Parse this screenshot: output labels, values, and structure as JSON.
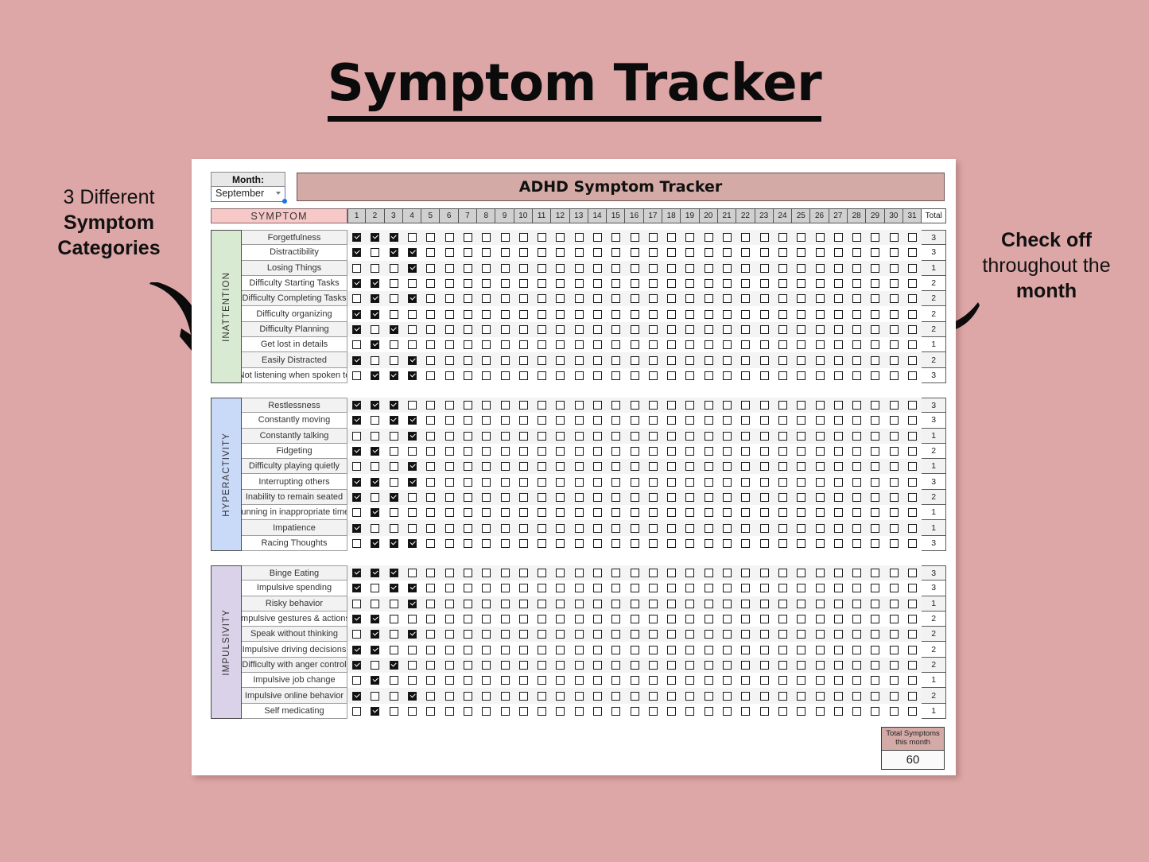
{
  "page": {
    "title": "Symptom Tracker",
    "background_color": "#dda7a7"
  },
  "annotations": {
    "left": {
      "line1": "3 Different",
      "line2": "Symptom",
      "line3": "Categories"
    },
    "right": {
      "line1": "Check off",
      "line2": "throughout the",
      "line3": "month"
    }
  },
  "sheet": {
    "month_label": "Month:",
    "month_value": "September",
    "title_bar": "ADHD Symptom Tracker",
    "symptom_header": "SYMPTOM",
    "days": [
      "1",
      "2",
      "3",
      "4",
      "5",
      "6",
      "7",
      "8",
      "9",
      "10",
      "11",
      "12",
      "13",
      "14",
      "15",
      "16",
      "17",
      "18",
      "19",
      "20",
      "21",
      "22",
      "23",
      "24",
      "25",
      "26",
      "27",
      "28",
      "29",
      "30",
      "31"
    ],
    "total_header": "Total",
    "footer": {
      "label": "Total Symptoms this month",
      "value": "60"
    },
    "category_colors": {
      "inattention": "#d9ead3",
      "hyperactivity": "#c9daf8",
      "impulsivity": "#d9d2e9",
      "header_pink": "#f6c8c8",
      "title_bar": "#d3aaa6"
    },
    "blocks": [
      {
        "category": "INATTENTION",
        "color": "#d9ead3",
        "rows": [
          {
            "name": "Forgetfulness",
            "checks": [
              1,
              1,
              1,
              0
            ],
            "total": "3"
          },
          {
            "name": "Distractibility",
            "checks": [
              1,
              0,
              1,
              1
            ],
            "total": "3"
          },
          {
            "name": "Losing Things",
            "checks": [
              0,
              0,
              0,
              1
            ],
            "total": "1"
          },
          {
            "name": "Difficulty Starting Tasks",
            "checks": [
              1,
              1,
              0,
              0
            ],
            "total": "2"
          },
          {
            "name": "Difficulty Completing Tasks",
            "checks": [
              0,
              1,
              0,
              1
            ],
            "total": "2"
          },
          {
            "name": "Difficulty organizing",
            "checks": [
              1,
              1,
              0,
              0
            ],
            "total": "2"
          },
          {
            "name": "Difficulty Planning",
            "checks": [
              1,
              0,
              1,
              0
            ],
            "total": "2"
          },
          {
            "name": "Get lost in details",
            "checks": [
              0,
              1,
              0,
              0
            ],
            "total": "1"
          },
          {
            "name": "Easily Distracted",
            "checks": [
              1,
              0,
              0,
              1
            ],
            "total": "2"
          },
          {
            "name": "Not listening when spoken to",
            "checks": [
              0,
              1,
              1,
              1
            ],
            "total": "3"
          }
        ]
      },
      {
        "category": "HYPERACTIVITY",
        "color": "#c9daf8",
        "rows": [
          {
            "name": "Restlessness",
            "checks": [
              1,
              1,
              1,
              0
            ],
            "total": "3"
          },
          {
            "name": "Constantly moving",
            "checks": [
              1,
              0,
              1,
              1
            ],
            "total": "3"
          },
          {
            "name": "Constantly talking",
            "checks": [
              0,
              0,
              0,
              1
            ],
            "total": "1"
          },
          {
            "name": "Fidgeting",
            "checks": [
              1,
              1,
              0,
              0
            ],
            "total": "2"
          },
          {
            "name": "Difficulty playing quietly",
            "checks": [
              0,
              0,
              0,
              1
            ],
            "total": "1"
          },
          {
            "name": "Interrupting others",
            "checks": [
              1,
              1,
              0,
              1
            ],
            "total": "3"
          },
          {
            "name": "Inability to remain seated",
            "checks": [
              1,
              0,
              1,
              0
            ],
            "total": "2"
          },
          {
            "name": "Running in inappropriate times",
            "checks": [
              0,
              1,
              0,
              0
            ],
            "total": "1"
          },
          {
            "name": "Impatience",
            "checks": [
              1,
              0,
              0,
              0
            ],
            "total": "1"
          },
          {
            "name": "Racing Thoughts",
            "checks": [
              0,
              1,
              1,
              1
            ],
            "total": "3"
          }
        ]
      },
      {
        "category": "IMPULSIVITY",
        "color": "#d9d2e9",
        "rows": [
          {
            "name": "Binge Eating",
            "checks": [
              1,
              1,
              1,
              0
            ],
            "total": "3"
          },
          {
            "name": "Impulsive spending",
            "checks": [
              1,
              0,
              1,
              1
            ],
            "total": "3"
          },
          {
            "name": "Risky behavior",
            "checks": [
              0,
              0,
              0,
              1
            ],
            "total": "1"
          },
          {
            "name": "Impulsive gestures & actions",
            "checks": [
              1,
              1,
              0,
              0
            ],
            "total": "2"
          },
          {
            "name": "Speak without thinking",
            "checks": [
              0,
              1,
              0,
              1
            ],
            "total": "2"
          },
          {
            "name": "Impulsive driving decisions",
            "checks": [
              1,
              1,
              0,
              0
            ],
            "total": "2"
          },
          {
            "name": "Difficulty with anger control",
            "checks": [
              1,
              0,
              1,
              0
            ],
            "total": "2"
          },
          {
            "name": "Impulsive job change",
            "checks": [
              0,
              1,
              0,
              0
            ],
            "total": "1"
          },
          {
            "name": "Impulsive online behavior",
            "checks": [
              1,
              0,
              0,
              1
            ],
            "total": "2"
          },
          {
            "name": "Self medicating",
            "checks": [
              0,
              1,
              0,
              0
            ],
            "total": "1"
          }
        ]
      }
    ]
  }
}
